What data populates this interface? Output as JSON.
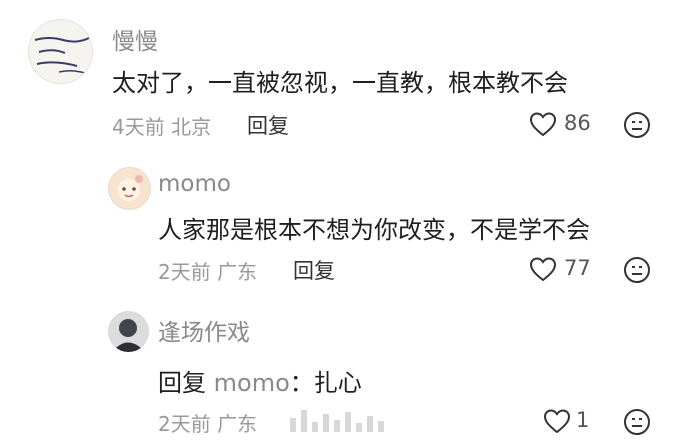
{
  "comments": [
    {
      "username": "慢慢",
      "text": "太对了，一直被忽视，一直教，根本教不会",
      "time": "4天前",
      "location": "北京",
      "reply_label": "回复",
      "likes": "86",
      "avatar_icon": "handwritten-note-avatar"
    },
    {
      "username": "momo",
      "text": "人家那是根本不想为你改变，不是学不会",
      "time": "2天前",
      "location": "广东",
      "reply_label": "回复",
      "likes": "77",
      "avatar_icon": "cartoon-avatar"
    },
    {
      "username": "逢场作戏",
      "reply_prefix": "回复",
      "reply_to": "momo",
      "reply_text": "：扎心",
      "time": "2天前",
      "location": "广东",
      "likes": "1",
      "avatar_icon": "dark-portrait-avatar"
    }
  ],
  "icons": {
    "like": "heart-outline-icon",
    "react": "emoji-face-icon"
  }
}
